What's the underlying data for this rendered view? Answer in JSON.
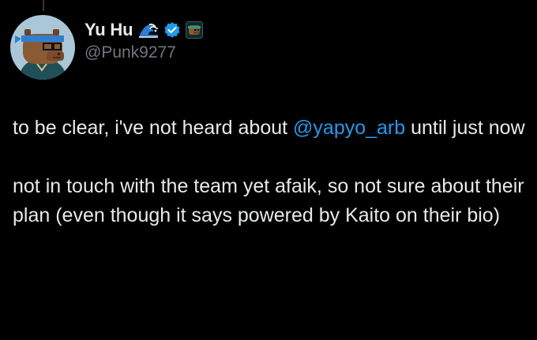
{
  "post": {
    "author": {
      "display_name": "Yu Hu",
      "handle": "@Punk9277",
      "badges": [
        "wave-emoji",
        "verified-badge-icon",
        "affiliate-icon"
      ]
    },
    "text": {
      "p1_before": "to be clear, i've not heard about ",
      "mention": "@yapyo_arb",
      "p1_after": " until just now",
      "p2": "not in touch with the team yet afaik, so not sure about their plan (even though it says powered by Kaito on their bio)"
    }
  },
  "colors": {
    "background": "#000000",
    "text": "#e7e9ea",
    "secondary_text": "#71767b",
    "link": "#1d9bf0",
    "verified": "#1d9bf0"
  }
}
